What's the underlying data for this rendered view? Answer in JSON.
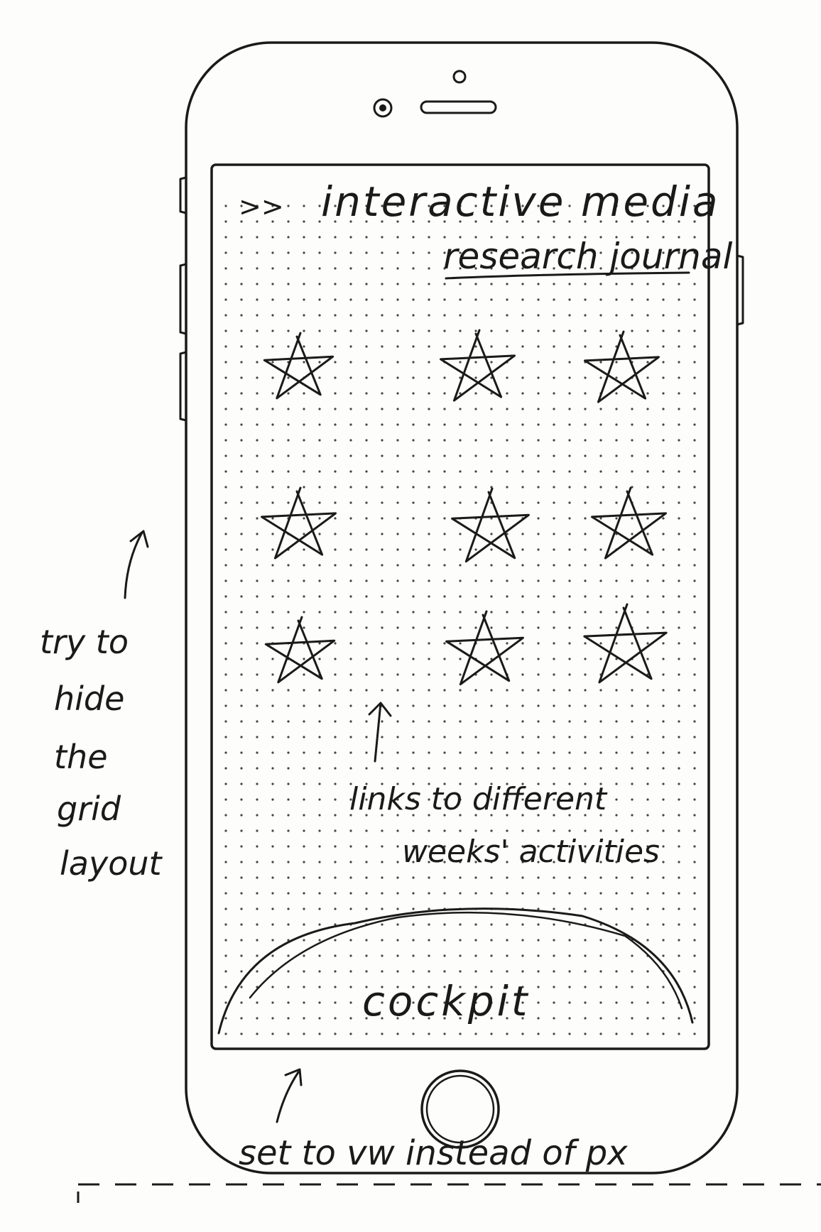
{
  "title_prefix": ">>",
  "title_line1": "interactive media",
  "title_line2": "research journal",
  "star_links": [
    {
      "label": "star"
    },
    {
      "label": "star"
    },
    {
      "label": "star"
    },
    {
      "label": "star"
    },
    {
      "label": "star"
    },
    {
      "label": "star"
    },
    {
      "label": "star"
    },
    {
      "label": "star"
    },
    {
      "label": "star"
    }
  ],
  "note_links_line1": "links to different",
  "note_links_line2": "weeks' activities",
  "cockpit_label": "cockpit",
  "side_note_lines": [
    "try to",
    "hide",
    "the",
    "grid",
    "layout"
  ],
  "bottom_note": "set to vw instead of px"
}
